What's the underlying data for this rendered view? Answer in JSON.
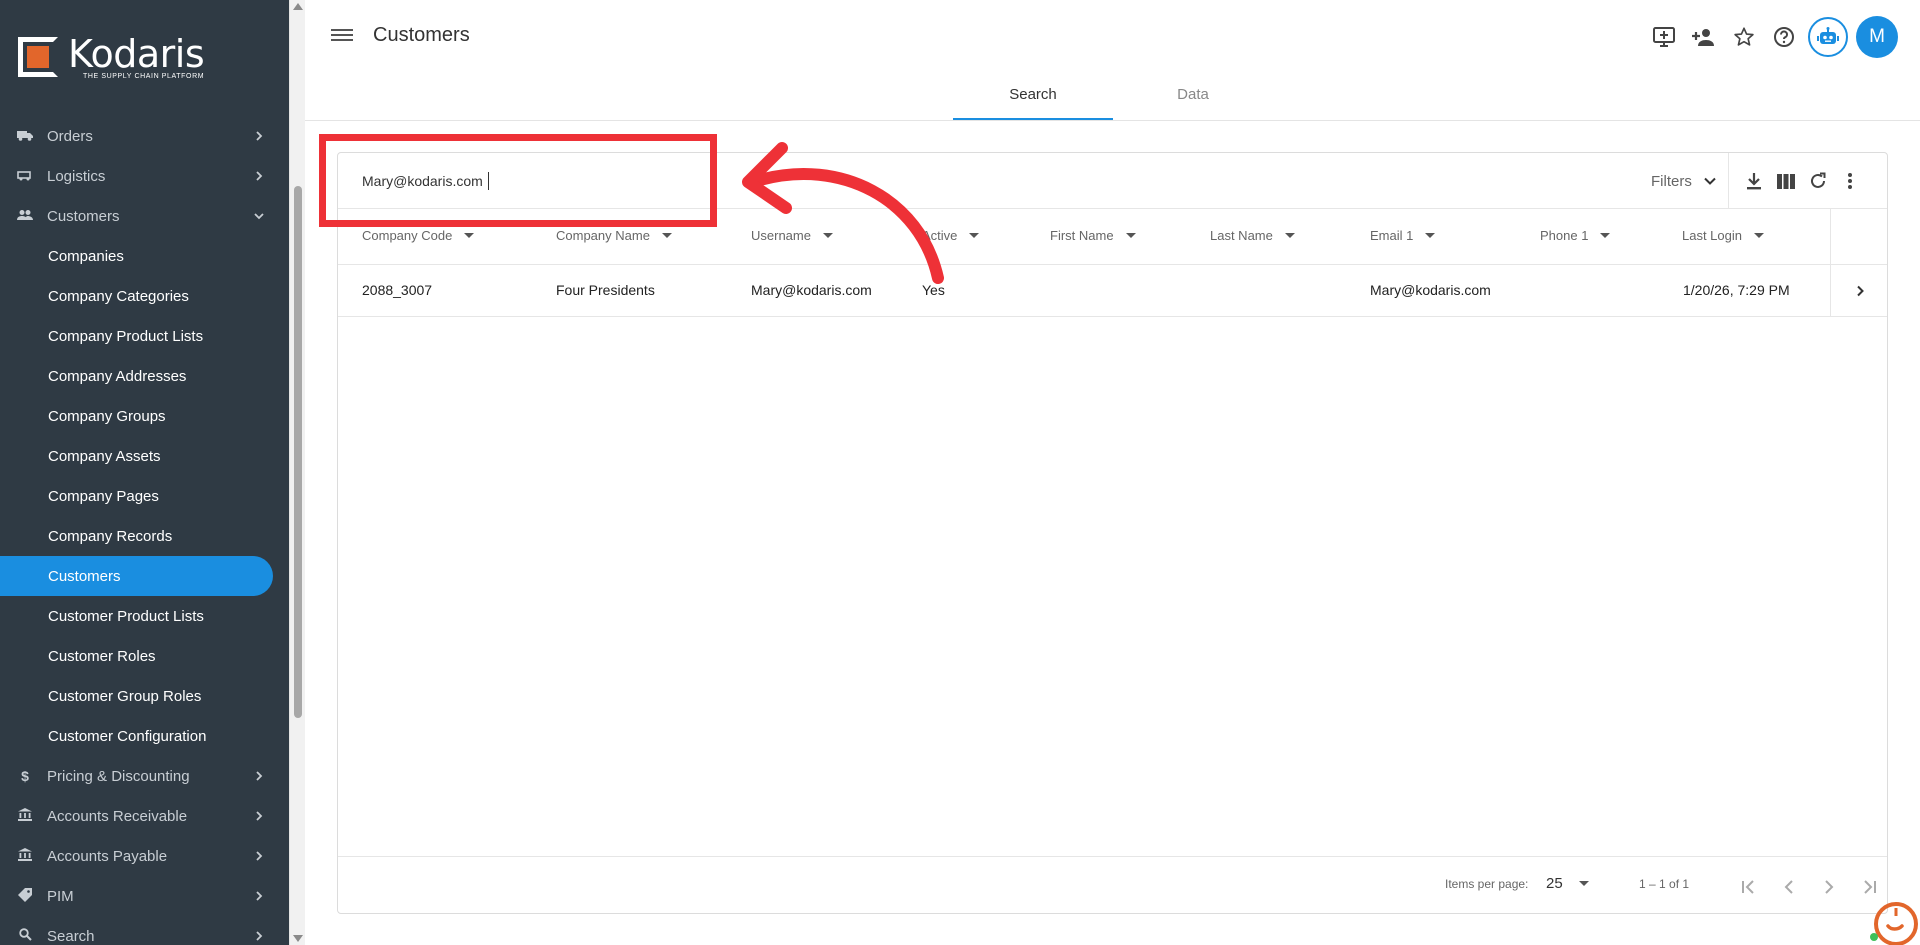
{
  "brand": {
    "name": "Kodaris",
    "tagline": "THE SUPPLY CHAIN PLATFORM",
    "accent": "#1a8ee0",
    "logo_accent": "#e2662b"
  },
  "sidebar": {
    "items": [
      {
        "label": "Orders",
        "icon": "truck-icon",
        "expanded": false
      },
      {
        "label": "Logistics",
        "icon": "shipping-icon",
        "expanded": false
      },
      {
        "label": "Customers",
        "icon": "people-icon",
        "expanded": true,
        "children": [
          "Companies",
          "Company Categories",
          "Company Product Lists",
          "Company Addresses",
          "Company Groups",
          "Company Assets",
          "Company Pages",
          "Company Records",
          "Customers",
          "Customer Product Lists",
          "Customer Roles",
          "Customer Group Roles",
          "Customer Configuration"
        ],
        "active_child": "Customers"
      },
      {
        "label": "Pricing & Discounting",
        "icon": "dollar-icon",
        "expanded": false
      },
      {
        "label": "Accounts Receivable",
        "icon": "bank-icon",
        "expanded": false
      },
      {
        "label": "Accounts Payable",
        "icon": "bank-icon",
        "expanded": false
      },
      {
        "label": "PIM",
        "icon": "tag-icon",
        "expanded": false
      },
      {
        "label": "Search",
        "icon": "search-icon",
        "expanded": false
      }
    ]
  },
  "header": {
    "title": "Customers",
    "avatar_initial": "M",
    "icons": [
      "add-screen-icon",
      "add-person-icon",
      "star-icon",
      "help-icon",
      "robot-icon"
    ]
  },
  "tabs": [
    {
      "label": "Search",
      "active": true
    },
    {
      "label": "Data",
      "active": false
    }
  ],
  "search": {
    "value": "Mary@kodaris.com",
    "filters_label": "Filters"
  },
  "table": {
    "columns": [
      "Company Code",
      "Company Name",
      "Username",
      "Active",
      "First Name",
      "Last Name",
      "Email 1",
      "Phone 1",
      "Last Login"
    ],
    "rows": [
      [
        "2088_3007",
        "Four Presidents",
        "Mary@kodaris.com",
        "Yes",
        "",
        "",
        "Mary@kodaris.com",
        "",
        "1/20/26, 7:29 PM"
      ]
    ]
  },
  "paginator": {
    "items_per_page_label": "Items per page:",
    "page_size": "25",
    "range": "1 – 1 of 1"
  },
  "annotation": {
    "color": "#ee3137"
  }
}
